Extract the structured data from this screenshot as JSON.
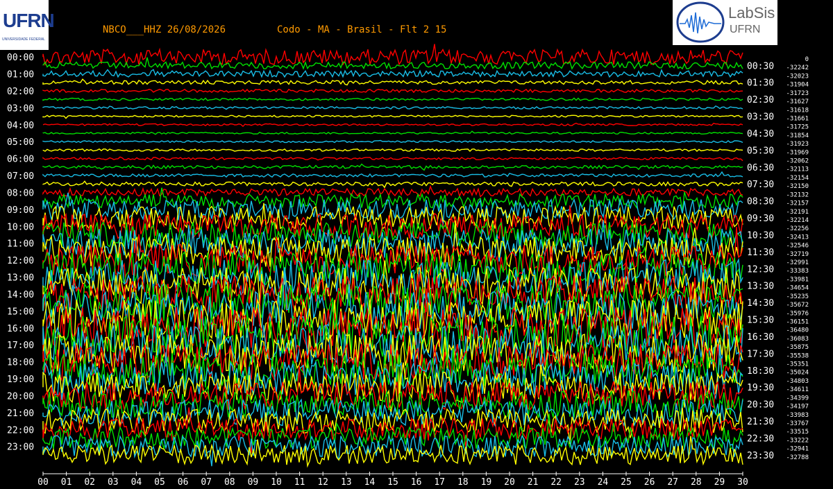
{
  "header": {
    "station": "NBCO___HHZ 26/08/2026",
    "location": "Codo - MA - Brasil - Flt 2 15"
  },
  "logos": {
    "left": "UFRN",
    "right_top": "LabSis",
    "right_bottom": "UFRN"
  },
  "colors": {
    "background": "#000000",
    "label": "#ffffff",
    "header": "#ff9a00",
    "traces": [
      "#ff0000",
      "#00e000",
      "#19bde6",
      "#ffff00"
    ]
  },
  "chart_data": {
    "type": "line",
    "title": "NBCO___HHZ 26/08/2026   Codo - MA - Brasil - Flt 2 15",
    "left_labels": [
      "00:00",
      "01:00",
      "02:00",
      "03:00",
      "04:00",
      "05:00",
      "06:00",
      "07:00",
      "08:00",
      "09:00",
      "10:00",
      "11:00",
      "12:00",
      "13:00",
      "14:00",
      "15:00",
      "16:00",
      "17:00",
      "18:00",
      "19:00",
      "20:00",
      "21:00",
      "22:00",
      "23:00"
    ],
    "right_labels": [
      "00:30",
      "01:30",
      "02:30",
      "03:30",
      "04:30",
      "05:30",
      "06:30",
      "07:30",
      "08:30",
      "09:30",
      "10:30",
      "11:30",
      "12:30",
      "13:30",
      "14:30",
      "15:30",
      "16:30",
      "17:30",
      "18:30",
      "19:30",
      "20:30",
      "21:30",
      "22:30",
      "23:30"
    ],
    "offset_labels": [
      "0",
      "-32242",
      "-32023",
      "-31904",
      "-31723",
      "-31627",
      "-31618",
      "-31661",
      "-31725",
      "-31854",
      "-31923",
      "-31969",
      "-32062",
      "-32113",
      "-32154",
      "-32150",
      "-32132",
      "-32157",
      "-32191",
      "-32214",
      "-32256",
      "-32413",
      "-32546",
      "-32719",
      "-32991",
      "-33383",
      "-33981",
      "-34654",
      "-35235",
      "-35672",
      "-35976",
      "-36151",
      "-36480",
      "-36083",
      "-35875",
      "-35538",
      "-35351",
      "-35024",
      "-34803",
      "-34611",
      "-34399",
      "-34197",
      "-33983",
      "-33767",
      "-33515",
      "-33222",
      "-32941",
      "-32788"
    ],
    "x_ticks": [
      "00",
      "01",
      "02",
      "03",
      "04",
      "05",
      "06",
      "07",
      "08",
      "09",
      "10",
      "11",
      "12",
      "13",
      "14",
      "15",
      "16",
      "17",
      "18",
      "19",
      "20",
      "21",
      "22",
      "23",
      "24",
      "25",
      "26",
      "27",
      "28",
      "29",
      "30"
    ],
    "xlim": [
      0,
      30
    ],
    "ylim": [
      0,
      24
    ],
    "amplitude_profile": [
      {
        "row": 0,
        "level": 1.0
      },
      {
        "row": 1,
        "level": 0.45
      },
      {
        "row": 2,
        "level": 0.4
      },
      {
        "row": 3,
        "level": 0.25
      },
      {
        "row": 4,
        "level": 0.2
      },
      {
        "row": 5,
        "level": 0.15
      },
      {
        "row": 6,
        "level": 0.15
      },
      {
        "row": 7,
        "level": 0.12
      },
      {
        "row": 8,
        "level": 0.12
      },
      {
        "row": 9,
        "level": 0.12
      },
      {
        "row": 10,
        "level": 0.12
      },
      {
        "row": 11,
        "level": 0.15
      },
      {
        "row": 12,
        "level": 0.15
      },
      {
        "row": 13,
        "level": 0.2
      },
      {
        "row": 14,
        "level": 0.2
      },
      {
        "row": 15,
        "level": 0.25
      },
      {
        "row": 16,
        "level": 0.5
      },
      {
        "row": 17,
        "level": 0.9
      },
      {
        "row": 18,
        "level": 1.3
      },
      {
        "row": 19,
        "level": 1.5
      },
      {
        "row": 20,
        "level": 1.6
      },
      {
        "row": 21,
        "level": 1.7
      },
      {
        "row": 22,
        "level": 1.9
      },
      {
        "row": 23,
        "level": 2.0
      },
      {
        "row": 24,
        "level": 2.1
      },
      {
        "row": 25,
        "level": 2.2
      },
      {
        "row": 26,
        "level": 2.3
      },
      {
        "row": 27,
        "level": 2.4
      },
      {
        "row": 28,
        "level": 2.4
      },
      {
        "row": 29,
        "level": 2.5
      },
      {
        "row": 30,
        "level": 2.5
      },
      {
        "row": 31,
        "level": 2.6
      },
      {
        "row": 32,
        "level": 2.7
      },
      {
        "row": 33,
        "level": 2.7
      },
      {
        "row": 34,
        "level": 2.6
      },
      {
        "row": 35,
        "level": 2.5
      },
      {
        "row": 36,
        "level": 2.4
      },
      {
        "row": 37,
        "level": 2.3
      },
      {
        "row": 38,
        "level": 2.2
      },
      {
        "row": 39,
        "level": 2.0
      },
      {
        "row": 40,
        "level": 1.9
      },
      {
        "row": 41,
        "level": 1.8
      },
      {
        "row": 42,
        "level": 1.7
      },
      {
        "row": 43,
        "level": 1.6
      },
      {
        "row": 44,
        "level": 1.5
      },
      {
        "row": 45,
        "level": 1.4
      },
      {
        "row": 46,
        "level": 1.4
      },
      {
        "row": 47,
        "level": 1.3
      }
    ]
  }
}
